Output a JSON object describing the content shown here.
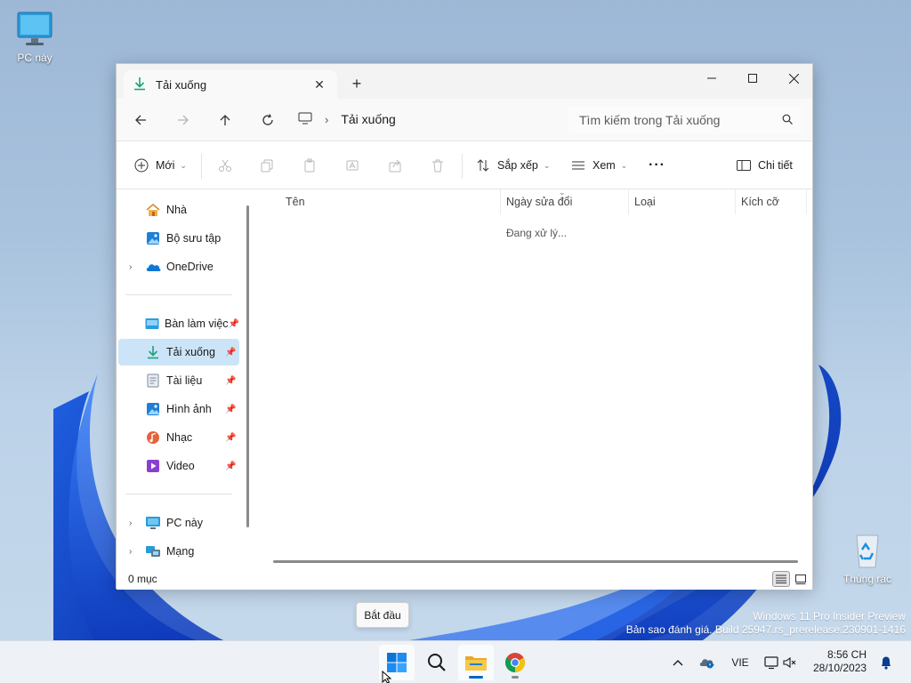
{
  "desktop": {
    "pc_label": "PC này",
    "recycle_label": "Thùng rác",
    "watermark_line1": "Windows 11 Pro Insider Preview",
    "watermark_line2": "Bản sao đánh giá. Build 25947.rs_prerelease.230901-1416"
  },
  "explorer": {
    "tab_title": "Tải xuống",
    "new_tab": "+",
    "breadcrumb": "Tải xuống",
    "search_placeholder": "Tìm kiếm trong Tải xuống",
    "commands": {
      "new": "Mới",
      "sort": "Sắp xếp",
      "view": "Xem",
      "more": "···",
      "details": "Chi tiết"
    },
    "sidebar": {
      "top": [
        {
          "label": "Nhà",
          "icon": "home-icon"
        },
        {
          "label": "Bộ sưu tập",
          "icon": "gallery-icon"
        },
        {
          "label": "OneDrive",
          "icon": "onedrive-icon"
        }
      ],
      "pinned": [
        {
          "label": "Bàn làm việc",
          "icon": "desktop-folder-icon"
        },
        {
          "label": "Tải xuống",
          "icon": "download-icon"
        },
        {
          "label": "Tài liệu",
          "icon": "document-icon"
        },
        {
          "label": "Hình ảnh",
          "icon": "pictures-icon"
        },
        {
          "label": "Nhạc",
          "icon": "music-icon"
        },
        {
          "label": "Video",
          "icon": "video-icon"
        }
      ],
      "bottom": [
        {
          "label": "PC này",
          "icon": "pc-icon"
        },
        {
          "label": "Mạng",
          "icon": "network-icon"
        }
      ]
    },
    "columns": [
      "Tên",
      "Ngày sửa đổi",
      "Loại",
      "Kích cỡ"
    ],
    "loading_text": "Đang xử lý...",
    "status_text": "0 mục"
  },
  "tooltip": "Bắt đầu",
  "taskbar": {
    "language": "VIE",
    "time": "8:56 CH",
    "date": "28/10/2023"
  },
  "colors": {
    "accent": "#0067c0",
    "selection": "#cce4f7",
    "folder_yellow": "#f2c14b"
  }
}
